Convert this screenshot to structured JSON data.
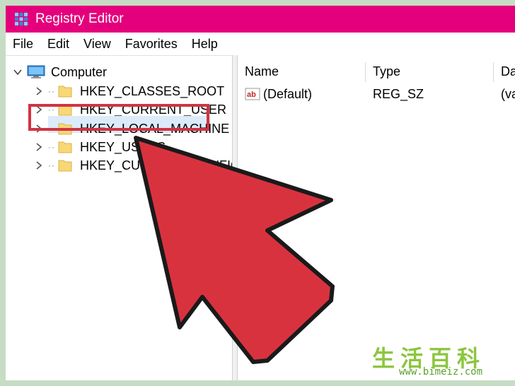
{
  "window": {
    "title": "Registry Editor",
    "accent_color": "#e4007c"
  },
  "menu": {
    "items": [
      "File",
      "Edit",
      "View",
      "Favorites",
      "Help"
    ]
  },
  "tree": {
    "root_label": "Computer",
    "root_icon": "computer-icon",
    "keys": [
      {
        "label": "HKEY_CLASSES_ROOT",
        "icon": "folder-icon"
      },
      {
        "label": "HKEY_CURRENT_USER",
        "icon": "folder-icon"
      },
      {
        "label": "HKEY_LOCAL_MACHINE",
        "icon": "folder-icon",
        "selected": true
      },
      {
        "label": "HKEY_USERS",
        "icon": "folder-icon"
      },
      {
        "label": "HKEY_CURRENT_CONFIG",
        "icon": "folder-icon"
      }
    ]
  },
  "list": {
    "columns": [
      "Name",
      "Type",
      "Data"
    ],
    "rows": [
      {
        "name": "(Default)",
        "type": "REG_SZ",
        "data": "(value not set)",
        "icon": "string-value-icon"
      }
    ]
  },
  "annotation": {
    "highlight_color": "#d23340",
    "arrow_color": "#d9323f"
  },
  "watermark": {
    "chars": "生活百科",
    "url": "www.bimeiz.com"
  }
}
